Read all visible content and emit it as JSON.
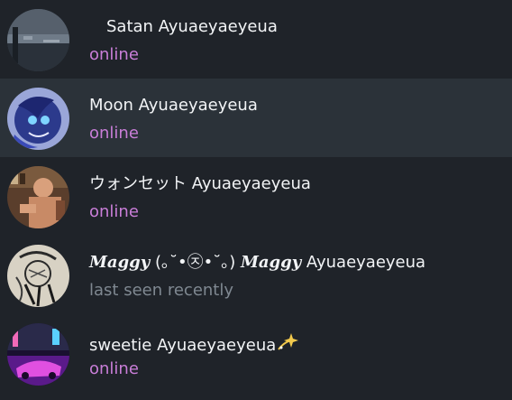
{
  "contacts": [
    {
      "name": "Satan Ayuaeyaeyeua",
      "status": "online",
      "avatar": "beach-photo"
    },
    {
      "name": "Moon Ayuaeyaeyeua",
      "status": "online",
      "avatar": "blue-pony-art"
    },
    {
      "name": "ウォンセット Ayuaeyaeyeua",
      "status": "online",
      "avatar": "man-photo"
    },
    {
      "name_part1": "𝑴𝒂𝒈𝒈𝒚",
      "name_part2": " (｡˘•㉨•˘｡) ",
      "name_part3": "𝑴𝒂𝒈𝒈𝒚",
      "name_part4": " Ayuaeyaeyeua",
      "status": "last seen recently",
      "avatar": "sketch-drawing"
    },
    {
      "name": "sweetie Ayuaeyaeyeua",
      "name_emoji": "dizzy-sparkle",
      "status": "online",
      "avatar": "neon-car-photo"
    }
  ],
  "colors": {
    "background": "#1f2329",
    "selected_row": "#2b3239",
    "name_text": "#f2f4f6",
    "online": "#c97ed8",
    "last_seen": "#7f8891"
  }
}
